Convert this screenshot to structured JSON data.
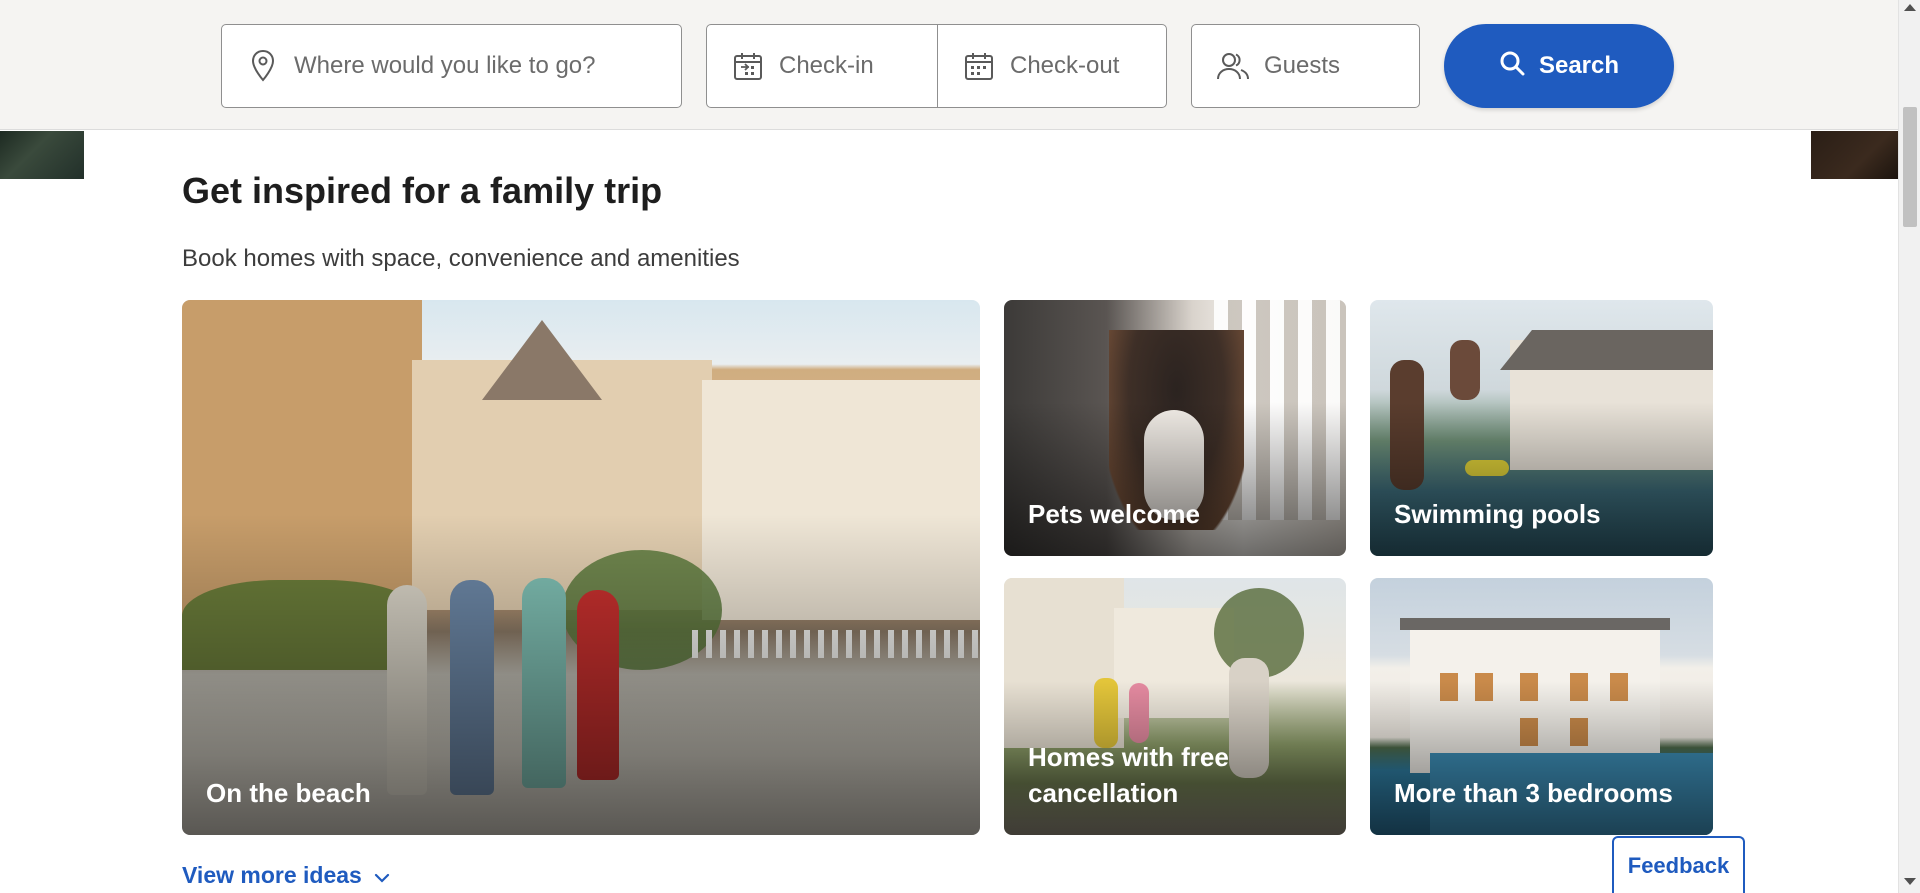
{
  "search": {
    "destination_placeholder": "Where would you like to go?",
    "checkin_placeholder": "Check-in",
    "checkout_placeholder": "Check-out",
    "guests_placeholder": "Guests",
    "search_label": "Search"
  },
  "section": {
    "title": "Get inspired for a family trip",
    "subtitle": "Book homes with space, convenience and amenities"
  },
  "cards": [
    {
      "label": "On the beach"
    },
    {
      "label": "Pets welcome"
    },
    {
      "label": "Swimming pools"
    },
    {
      "label": "Homes with free cancellation"
    },
    {
      "label": "More than 3 bedrooms"
    }
  ],
  "view_more": {
    "label": "View more ideas"
  },
  "feedback": {
    "label": "Feedback"
  },
  "colors": {
    "brand_blue": "#1f5bbf",
    "search_bar_bg": "#f5f4f2"
  },
  "icons": {
    "destination": "map-pin-icon",
    "checkin": "calendar-in-icon",
    "checkout": "calendar-out-icon",
    "guests": "users-icon",
    "search": "search-icon",
    "view_more": "chevron-down-icon"
  }
}
